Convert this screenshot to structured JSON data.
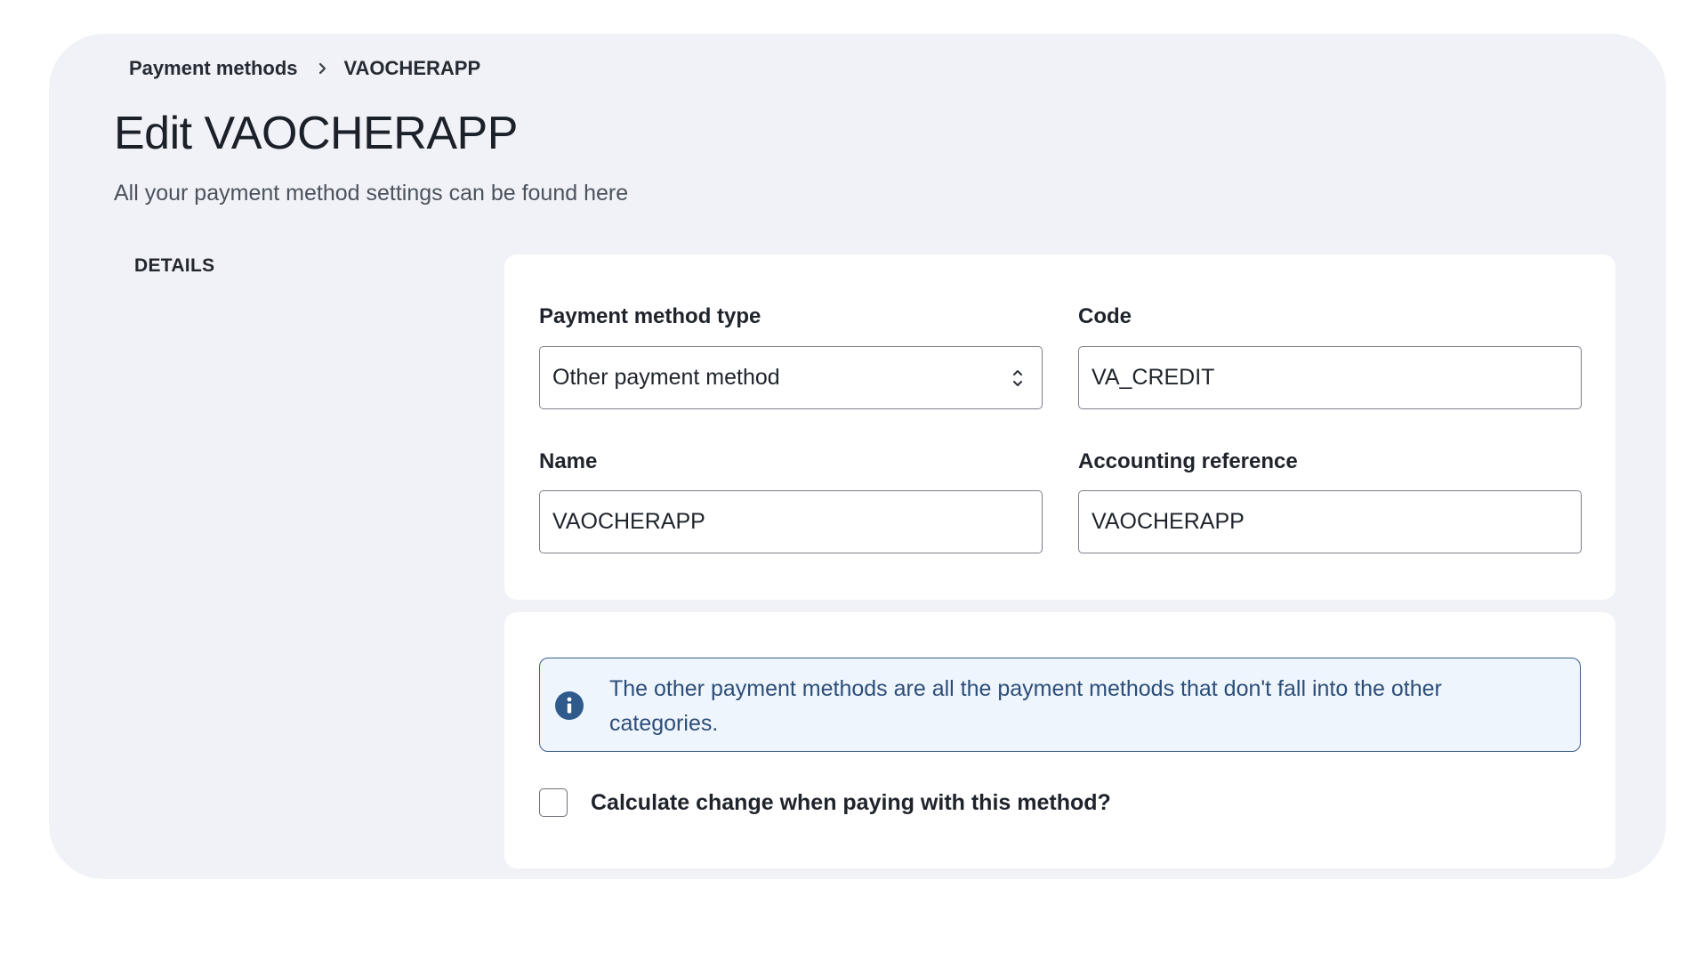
{
  "breadcrumb": {
    "parent": "Payment methods",
    "current": "VAOCHERAPP"
  },
  "page": {
    "title": "Edit VAOCHERAPP",
    "subtitle": "All your payment method settings can be found here",
    "section": "DETAILS"
  },
  "form": {
    "payment_method_type": {
      "label": "Payment method type",
      "value": "Other payment method"
    },
    "code": {
      "label": "Code",
      "value": "VA_CREDIT"
    },
    "name": {
      "label": "Name",
      "value": "VAOCHERAPP"
    },
    "accounting_reference": {
      "label": "Accounting reference",
      "value": "VAOCHERAPP"
    }
  },
  "info": {
    "text": "The other payment methods are all the payment methods that don't fall into the other categories."
  },
  "options": {
    "calculate_change": {
      "label": "Calculate change when paying with this method?",
      "checked": false
    }
  },
  "colors": {
    "panel_bg": "#f0f2f7",
    "info_bg": "#eef5fd",
    "info_border": "#3b5f8a",
    "info_icon": "#2f5a8c"
  }
}
